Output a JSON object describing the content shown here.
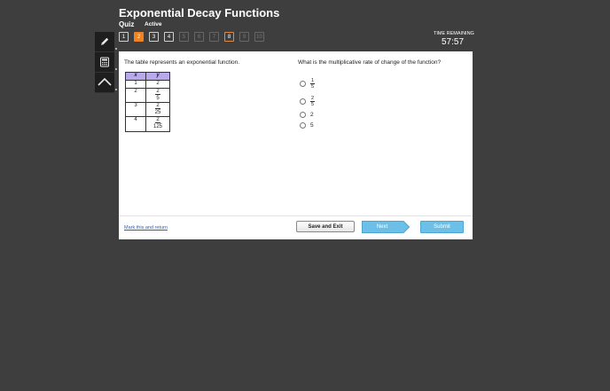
{
  "header": {
    "title": "Exponential Decay Functions",
    "quiz_label": "Quiz",
    "status": "Active"
  },
  "question_nav": [
    {
      "label": "1",
      "state": "answered"
    },
    {
      "label": "2",
      "state": "current"
    },
    {
      "label": "3",
      "state": "answered"
    },
    {
      "label": "4",
      "state": "answered"
    },
    {
      "label": "5",
      "state": "unavailable"
    },
    {
      "label": "6",
      "state": "unavailable"
    },
    {
      "label": "7",
      "state": "unavailable"
    },
    {
      "label": "8",
      "state": "visited"
    },
    {
      "label": "9",
      "state": "unavailable"
    },
    {
      "label": "10",
      "state": "unavailable"
    }
  ],
  "timer": {
    "label": "TIME REMAINING",
    "value": "57:57"
  },
  "tools": [
    "pencil-icon",
    "calculator-icon",
    "collapse-icon"
  ],
  "question": {
    "stem_left": "The table represents an exponential function.",
    "stem_right": "What is the multiplicative rate of change of the function?",
    "table": {
      "headers": [
        "x",
        "y"
      ],
      "rows": [
        {
          "x": "1",
          "y_whole": "2"
        },
        {
          "x": "2",
          "y_num": "2",
          "y_den": "5"
        },
        {
          "x": "3",
          "y_num": "2",
          "y_den": "25"
        },
        {
          "x": "4",
          "y_num": "2",
          "y_den": "125"
        }
      ]
    },
    "options": [
      {
        "num": "1",
        "den": "5"
      },
      {
        "num": "2",
        "den": "5"
      },
      {
        "text": "2"
      },
      {
        "text": "5"
      }
    ]
  },
  "footer": {
    "mark_link": "Mark this and return",
    "save_label": "Save and Exit",
    "next_label": "Next",
    "submit_label": "Submit"
  },
  "colors": {
    "background": "#3e3e3e",
    "current_question": "#f0821f",
    "table_header": "#b7a9ec",
    "next_button": "#6cc0e8",
    "link": "#2e60c4"
  }
}
